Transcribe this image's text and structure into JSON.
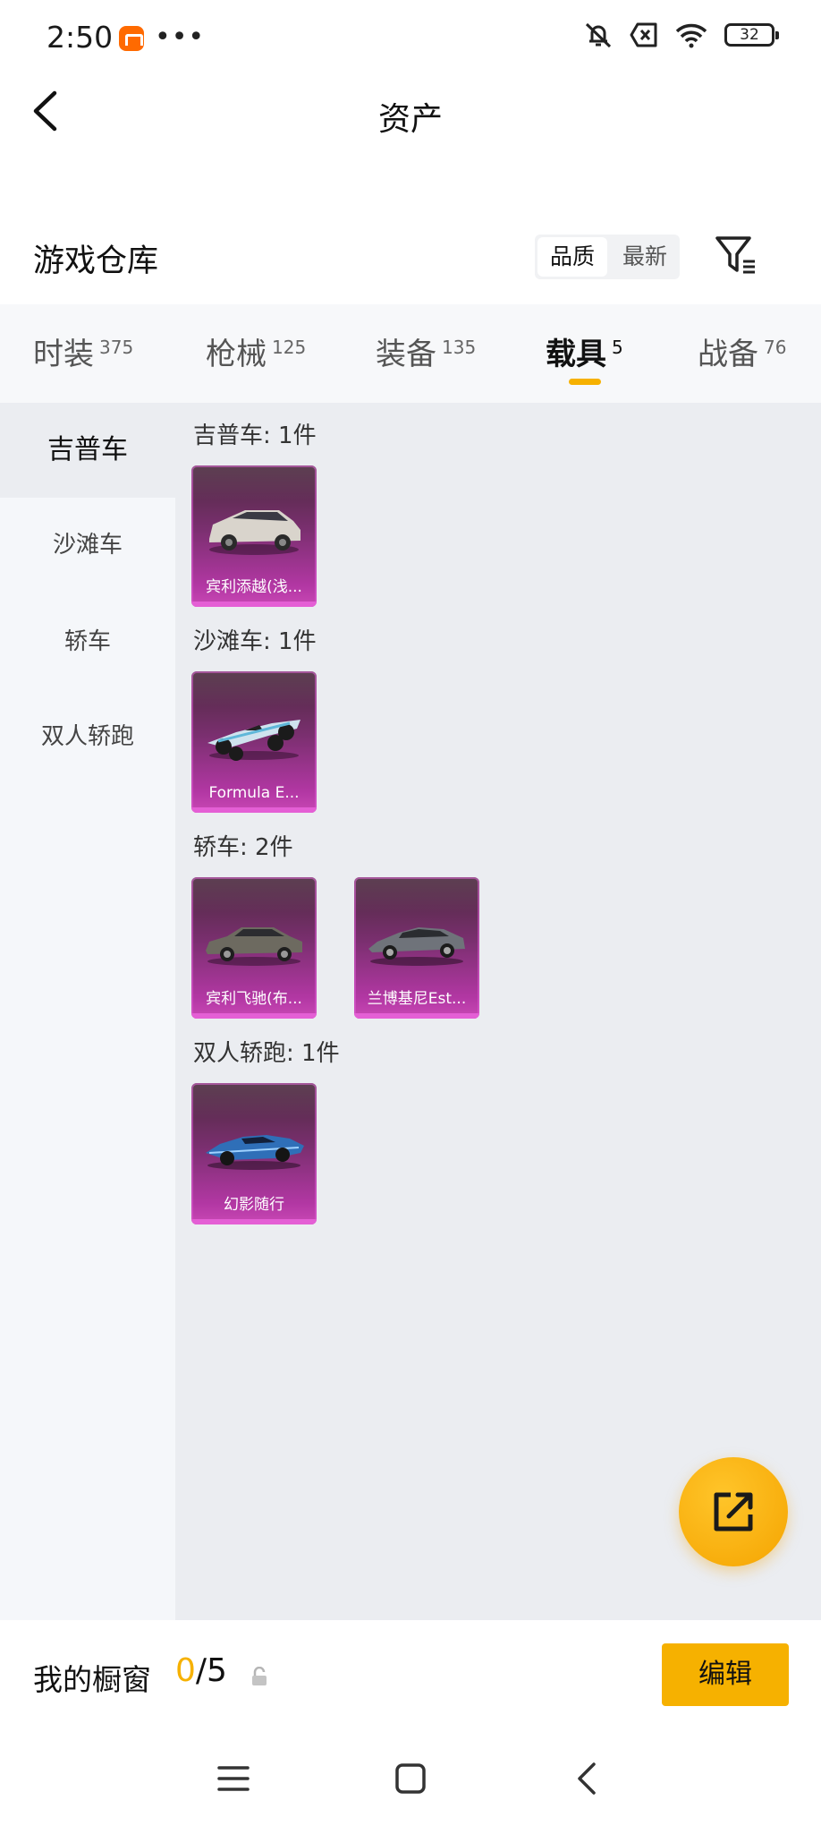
{
  "status_bar": {
    "time": "2:50",
    "battery": "32",
    "icons": [
      "mi-app-icon",
      "more-dots-icon",
      "mute-icon",
      "no-sim-icon",
      "wifi-icon",
      "battery-icon"
    ]
  },
  "header": {
    "title": "资产"
  },
  "warehouse": {
    "title": "游戏仓库",
    "sort_options": [
      "品质",
      "最新"
    ],
    "active_sort": "品质"
  },
  "tabs": [
    {
      "label": "时装",
      "count": "375"
    },
    {
      "label": "枪械",
      "count": "125"
    },
    {
      "label": "装备",
      "count": "135"
    },
    {
      "label": "载具",
      "count": "5",
      "active": true
    },
    {
      "label": "战备",
      "count": "76"
    }
  ],
  "sidebar": {
    "items": [
      "吉普车",
      "沙滩车",
      "轿车",
      "双人轿跑"
    ],
    "active_index": 0
  },
  "groups": [
    {
      "title": "吉普车: 1件",
      "items": [
        {
          "name": "宾利添越(浅..."
        }
      ]
    },
    {
      "title": "沙滩车: 1件",
      "items": [
        {
          "name": "Formula E..."
        }
      ]
    },
    {
      "title": "轿车: 2件",
      "items": [
        {
          "name": "宾利飞驰(布..."
        },
        {
          "name": "兰博基尼Est..."
        }
      ]
    },
    {
      "title": "双人轿跑: 1件",
      "items": [
        {
          "name": "幻影随行"
        }
      ]
    }
  ],
  "showcase": {
    "label": "我的橱窗",
    "current": "0",
    "separator_total": "/5",
    "edit_label": "编辑"
  },
  "colors": {
    "accent": "#f6b100",
    "card": "#b237a3"
  }
}
